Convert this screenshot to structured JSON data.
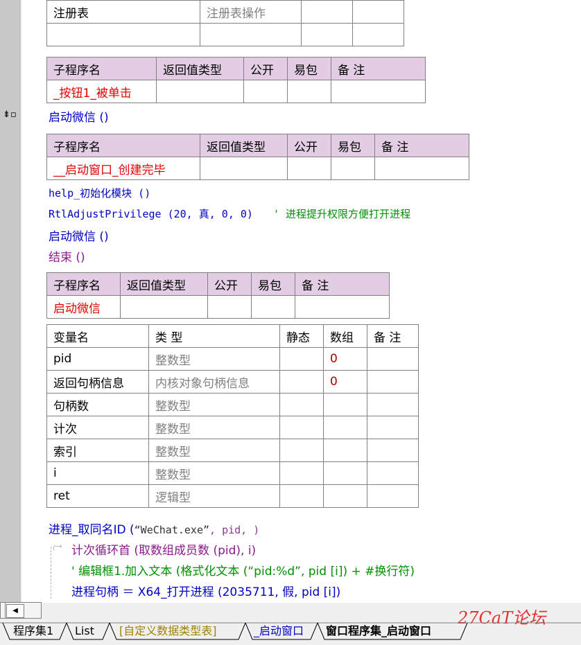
{
  "registry_table": {
    "name": "注册表",
    "op": "注册表操作"
  },
  "sub1": {
    "headers": [
      "子程序名",
      "返回值类型",
      "公开",
      "易包",
      "备 注"
    ],
    "name": "_按钮1_被单击",
    "call": "启动微信 ()"
  },
  "sub2": {
    "headers": [
      "子程序名",
      "返回值类型",
      "公开",
      "易包",
      "备 注"
    ],
    "name": "__启动窗口_创建完毕",
    "lines": {
      "l1": "help_初始化模块 ()",
      "l2_code": "RtlAdjustPrivilege (20, 真, 0, 0)",
      "l2_comment": "' 进程提升权限方便打开进程",
      "l3": "启动微信 ()",
      "l4": "结束 ()"
    }
  },
  "sub3": {
    "headers": [
      "子程序名",
      "返回值类型",
      "公开",
      "易包",
      "备 注"
    ],
    "name": "启动微信"
  },
  "vars": {
    "headers": [
      "变量名",
      "类 型",
      "静态",
      "数组",
      "备 注"
    ],
    "rows": [
      {
        "name": "pid",
        "type": "整数型",
        "array": "0"
      },
      {
        "name": "返回句柄信息",
        "type": "内核对象句柄信息",
        "array": "0"
      },
      {
        "name": "句柄数",
        "type": "整数型",
        "array": ""
      },
      {
        "name": "计次",
        "type": "整数型",
        "array": ""
      },
      {
        "name": "索引",
        "type": "整数型",
        "array": ""
      },
      {
        "name": "i",
        "type": "整数型",
        "array": ""
      },
      {
        "name": "ret",
        "type": "逻辑型",
        "array": ""
      }
    ]
  },
  "code": {
    "c1_fn": "进程_取同名ID (",
    "c1_str": "“WeChat.exe”",
    "c1_rest": ", pid, )",
    "c2": "计次循环首 (取数组成员数 (pid), i)",
    "c3": "' 编辑框1.加入文本 (格式化文本 (“pid:%d”, pid [i]) + #换行符)",
    "c4": "进程句柄 ＝ X64_打开进程 (2035711, 假, pid [i])"
  },
  "tabs": [
    "程序集1",
    "List",
    "[自定义数据类型表]",
    "_启动窗口",
    "窗口程序集_启动窗口"
  ],
  "watermark": "27CaT论坛",
  "icons": {
    "gutter_marker": "breakpoint-arrow-icon",
    "scroll_left": "arrow-left-icon"
  }
}
